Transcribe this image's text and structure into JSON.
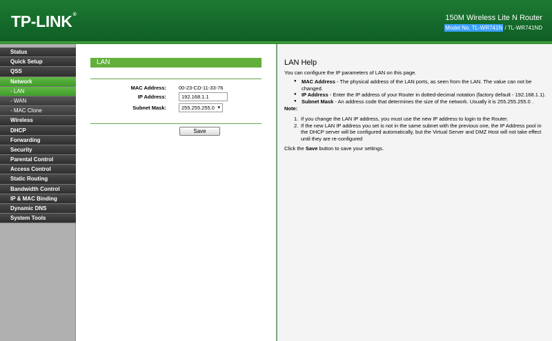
{
  "header": {
    "logo": "TP-LINK",
    "logo_reg": "®",
    "product": "150M Wireless Lite N Router",
    "model_highlight": "Model No. TL-WR741N",
    "model_rest": " / TL-WR741ND"
  },
  "sidebar": {
    "items": [
      {
        "label": "Status"
      },
      {
        "label": "Quick Setup"
      },
      {
        "label": "QSS"
      },
      {
        "label": "Network"
      },
      {
        "label": "- LAN"
      },
      {
        "label": "- WAN"
      },
      {
        "label": "- MAC Clone"
      },
      {
        "label": "Wireless"
      },
      {
        "label": "DHCP"
      },
      {
        "label": "Forwarding"
      },
      {
        "label": "Security"
      },
      {
        "label": "Parental Control"
      },
      {
        "label": "Access Control"
      },
      {
        "label": "Static Routing"
      },
      {
        "label": "Bandwidth Control"
      },
      {
        "label": "IP & MAC Binding"
      },
      {
        "label": "Dynamic DNS"
      },
      {
        "label": "System Tools"
      }
    ]
  },
  "main": {
    "section_title": "LAN",
    "mac_label": "MAC Address:",
    "mac_value": "00-23-CD-11-33-76",
    "ip_label": "IP Address:",
    "ip_value": "192.168.1.1",
    "mask_label": "Subnet Mask:",
    "mask_value": "255.255.255.0",
    "save_label": "Save"
  },
  "help": {
    "title": "LAN Help",
    "intro": "You can configure the IP parameters of LAN on this page.",
    "bullets": [
      {
        "term": "MAC Address",
        "text": " - The physical address of the LAN ports, as seen from the LAN. The value can not be changed."
      },
      {
        "term": "IP Address",
        "text": " - Enter the IP address of your Router in dotted-decimal notation (factory default - 192.168.1.1)."
      },
      {
        "term": "Subnet Mask",
        "text": " - An address code that determines the size of the network. Usually it is 255.255.255.0 ."
      }
    ],
    "note_label": "Note:",
    "notes": [
      {
        "num": "1.",
        "text": "If you change the LAN IP address, you must use the new IP address to login to the Router."
      },
      {
        "num": "2.",
        "text": "If the new LAN IP address you set is not in the same subnet with the previous one, the IP Address pool in the DHCP server will be configured automatically, but the Virtual Server and DMZ Host will not take effect until they are re-configured"
      }
    ],
    "footer_pre": "Click the ",
    "footer_bold": "Save",
    "footer_post": " button to save your settings."
  },
  "colors": {
    "header_green": "#14692a",
    "active_green": "#62b03b",
    "nav_dark": "#3a3a3a"
  }
}
